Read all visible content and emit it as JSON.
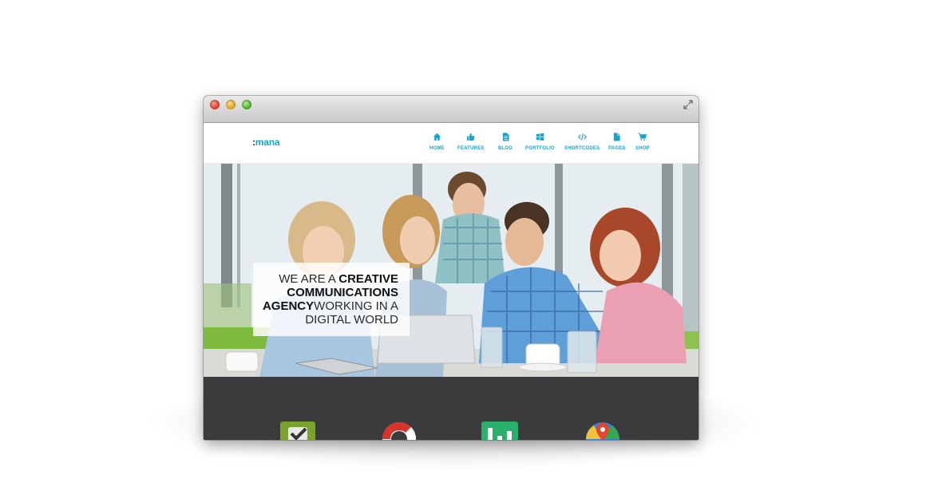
{
  "site": {
    "logo_prefix": ":",
    "logo_text": "mana"
  },
  "nav": [
    {
      "label": "HOME",
      "icon": "home-icon"
    },
    {
      "label": "FEATURES",
      "icon": "thumbs-up-icon"
    },
    {
      "label": "BLOG",
      "icon": "document-icon"
    },
    {
      "label": "PORTFOLIO",
      "icon": "windows-grid-icon"
    },
    {
      "label": "SHORTCODES",
      "icon": "code-icon"
    },
    {
      "label": "PAGES",
      "icon": "page-icon"
    },
    {
      "label": "SHOP",
      "icon": "cart-icon"
    }
  ],
  "hero": {
    "line1_light": "WE ARE A ",
    "line1_bold": "CREATIVE",
    "line2_bold": "COMMUNICATIONS",
    "line3_bold": "AGENCY",
    "line3_light": "WORKING IN A",
    "line4_light": "DIGITAL WORLD"
  },
  "colors": {
    "accent": "#1aa3c9",
    "dark_band": "#3b3a3c"
  },
  "feature_icons": [
    "checkbox-icon",
    "lifebuoy-icon",
    "bar-chart-icon",
    "map-pin-icon"
  ]
}
